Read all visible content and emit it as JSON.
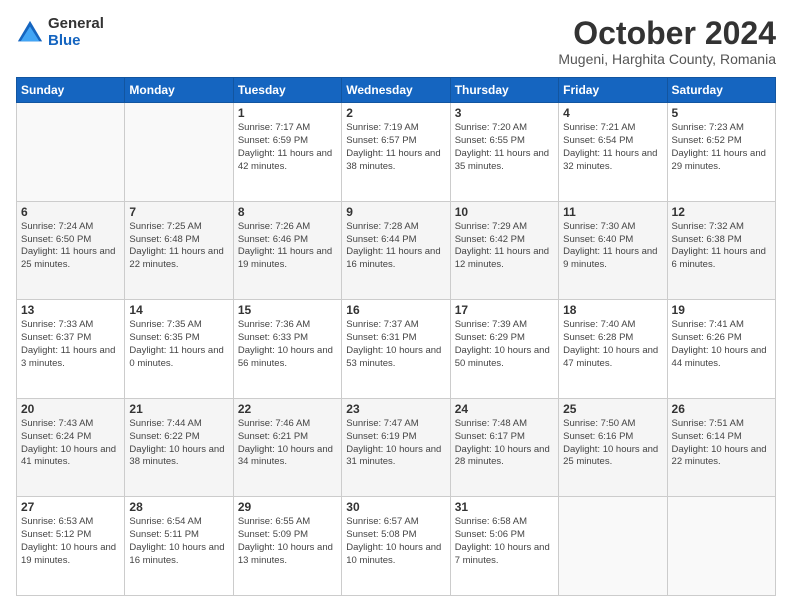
{
  "logo": {
    "general": "General",
    "blue": "Blue"
  },
  "header": {
    "month": "October 2024",
    "location": "Mugeni, Harghita County, Romania"
  },
  "weekdays": [
    "Sunday",
    "Monday",
    "Tuesday",
    "Wednesday",
    "Thursday",
    "Friday",
    "Saturday"
  ],
  "weeks": [
    [
      {
        "day": "",
        "sunrise": "",
        "sunset": "",
        "daylight": ""
      },
      {
        "day": "",
        "sunrise": "",
        "sunset": "",
        "daylight": ""
      },
      {
        "day": "1",
        "sunrise": "Sunrise: 7:17 AM",
        "sunset": "Sunset: 6:59 PM",
        "daylight": "Daylight: 11 hours and 42 minutes."
      },
      {
        "day": "2",
        "sunrise": "Sunrise: 7:19 AM",
        "sunset": "Sunset: 6:57 PM",
        "daylight": "Daylight: 11 hours and 38 minutes."
      },
      {
        "day": "3",
        "sunrise": "Sunrise: 7:20 AM",
        "sunset": "Sunset: 6:55 PM",
        "daylight": "Daylight: 11 hours and 35 minutes."
      },
      {
        "day": "4",
        "sunrise": "Sunrise: 7:21 AM",
        "sunset": "Sunset: 6:54 PM",
        "daylight": "Daylight: 11 hours and 32 minutes."
      },
      {
        "day": "5",
        "sunrise": "Sunrise: 7:23 AM",
        "sunset": "Sunset: 6:52 PM",
        "daylight": "Daylight: 11 hours and 29 minutes."
      }
    ],
    [
      {
        "day": "6",
        "sunrise": "Sunrise: 7:24 AM",
        "sunset": "Sunset: 6:50 PM",
        "daylight": "Daylight: 11 hours and 25 minutes."
      },
      {
        "day": "7",
        "sunrise": "Sunrise: 7:25 AM",
        "sunset": "Sunset: 6:48 PM",
        "daylight": "Daylight: 11 hours and 22 minutes."
      },
      {
        "day": "8",
        "sunrise": "Sunrise: 7:26 AM",
        "sunset": "Sunset: 6:46 PM",
        "daylight": "Daylight: 11 hours and 19 minutes."
      },
      {
        "day": "9",
        "sunrise": "Sunrise: 7:28 AM",
        "sunset": "Sunset: 6:44 PM",
        "daylight": "Daylight: 11 hours and 16 minutes."
      },
      {
        "day": "10",
        "sunrise": "Sunrise: 7:29 AM",
        "sunset": "Sunset: 6:42 PM",
        "daylight": "Daylight: 11 hours and 12 minutes."
      },
      {
        "day": "11",
        "sunrise": "Sunrise: 7:30 AM",
        "sunset": "Sunset: 6:40 PM",
        "daylight": "Daylight: 11 hours and 9 minutes."
      },
      {
        "day": "12",
        "sunrise": "Sunrise: 7:32 AM",
        "sunset": "Sunset: 6:38 PM",
        "daylight": "Daylight: 11 hours and 6 minutes."
      }
    ],
    [
      {
        "day": "13",
        "sunrise": "Sunrise: 7:33 AM",
        "sunset": "Sunset: 6:37 PM",
        "daylight": "Daylight: 11 hours and 3 minutes."
      },
      {
        "day": "14",
        "sunrise": "Sunrise: 7:35 AM",
        "sunset": "Sunset: 6:35 PM",
        "daylight": "Daylight: 11 hours and 0 minutes."
      },
      {
        "day": "15",
        "sunrise": "Sunrise: 7:36 AM",
        "sunset": "Sunset: 6:33 PM",
        "daylight": "Daylight: 10 hours and 56 minutes."
      },
      {
        "day": "16",
        "sunrise": "Sunrise: 7:37 AM",
        "sunset": "Sunset: 6:31 PM",
        "daylight": "Daylight: 10 hours and 53 minutes."
      },
      {
        "day": "17",
        "sunrise": "Sunrise: 7:39 AM",
        "sunset": "Sunset: 6:29 PM",
        "daylight": "Daylight: 10 hours and 50 minutes."
      },
      {
        "day": "18",
        "sunrise": "Sunrise: 7:40 AM",
        "sunset": "Sunset: 6:28 PM",
        "daylight": "Daylight: 10 hours and 47 minutes."
      },
      {
        "day": "19",
        "sunrise": "Sunrise: 7:41 AM",
        "sunset": "Sunset: 6:26 PM",
        "daylight": "Daylight: 10 hours and 44 minutes."
      }
    ],
    [
      {
        "day": "20",
        "sunrise": "Sunrise: 7:43 AM",
        "sunset": "Sunset: 6:24 PM",
        "daylight": "Daylight: 10 hours and 41 minutes."
      },
      {
        "day": "21",
        "sunrise": "Sunrise: 7:44 AM",
        "sunset": "Sunset: 6:22 PM",
        "daylight": "Daylight: 10 hours and 38 minutes."
      },
      {
        "day": "22",
        "sunrise": "Sunrise: 7:46 AM",
        "sunset": "Sunset: 6:21 PM",
        "daylight": "Daylight: 10 hours and 34 minutes."
      },
      {
        "day": "23",
        "sunrise": "Sunrise: 7:47 AM",
        "sunset": "Sunset: 6:19 PM",
        "daylight": "Daylight: 10 hours and 31 minutes."
      },
      {
        "day": "24",
        "sunrise": "Sunrise: 7:48 AM",
        "sunset": "Sunset: 6:17 PM",
        "daylight": "Daylight: 10 hours and 28 minutes."
      },
      {
        "day": "25",
        "sunrise": "Sunrise: 7:50 AM",
        "sunset": "Sunset: 6:16 PM",
        "daylight": "Daylight: 10 hours and 25 minutes."
      },
      {
        "day": "26",
        "sunrise": "Sunrise: 7:51 AM",
        "sunset": "Sunset: 6:14 PM",
        "daylight": "Daylight: 10 hours and 22 minutes."
      }
    ],
    [
      {
        "day": "27",
        "sunrise": "Sunrise: 6:53 AM",
        "sunset": "Sunset: 5:12 PM",
        "daylight": "Daylight: 10 hours and 19 minutes."
      },
      {
        "day": "28",
        "sunrise": "Sunrise: 6:54 AM",
        "sunset": "Sunset: 5:11 PM",
        "daylight": "Daylight: 10 hours and 16 minutes."
      },
      {
        "day": "29",
        "sunrise": "Sunrise: 6:55 AM",
        "sunset": "Sunset: 5:09 PM",
        "daylight": "Daylight: 10 hours and 13 minutes."
      },
      {
        "day": "30",
        "sunrise": "Sunrise: 6:57 AM",
        "sunset": "Sunset: 5:08 PM",
        "daylight": "Daylight: 10 hours and 10 minutes."
      },
      {
        "day": "31",
        "sunrise": "Sunrise: 6:58 AM",
        "sunset": "Sunset: 5:06 PM",
        "daylight": "Daylight: 10 hours and 7 minutes."
      },
      {
        "day": "",
        "sunrise": "",
        "sunset": "",
        "daylight": ""
      },
      {
        "day": "",
        "sunrise": "",
        "sunset": "",
        "daylight": ""
      }
    ]
  ]
}
